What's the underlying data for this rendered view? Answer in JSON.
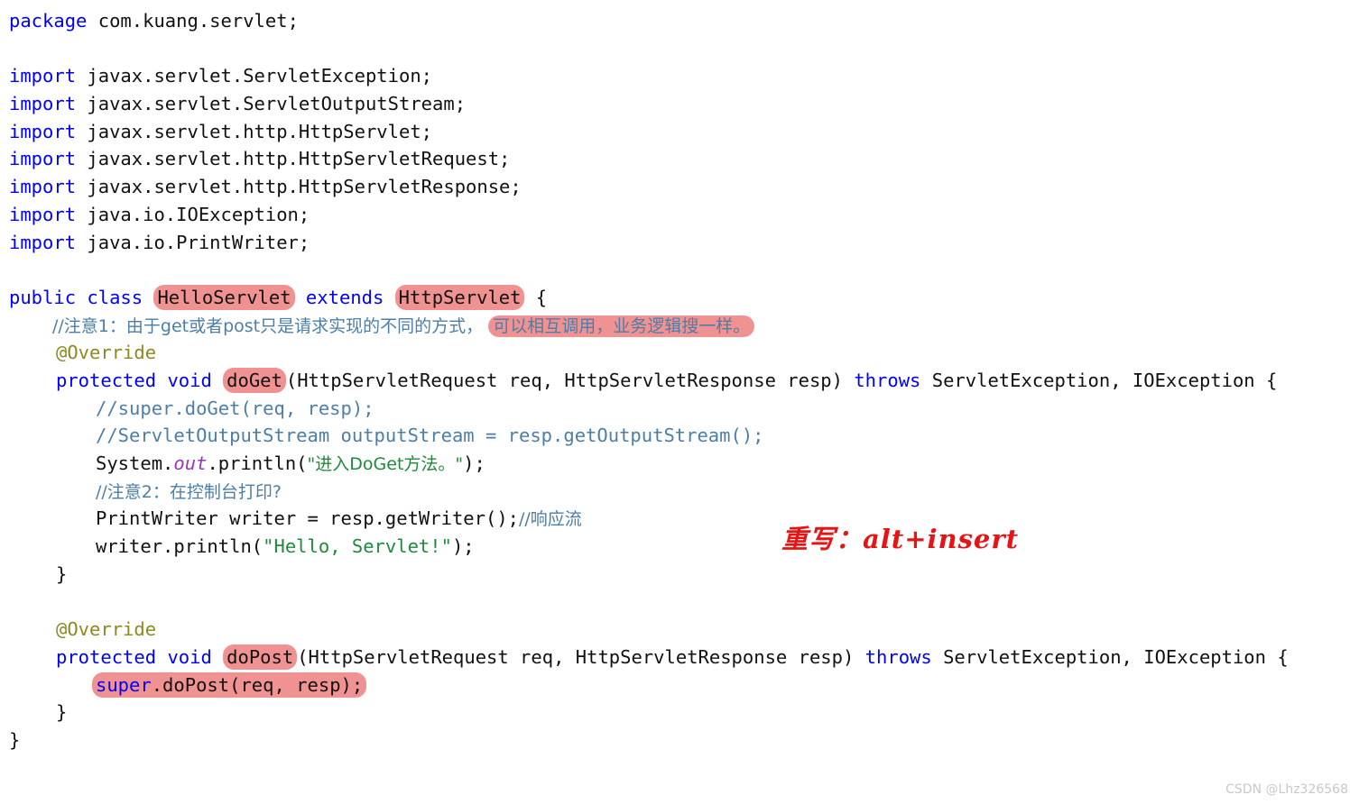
{
  "editor": {
    "language": "java",
    "colors": {
      "keyword": "#0000ff",
      "plain": "#111111",
      "comment": "#4c7ea8",
      "string": "#1f8a3c",
      "annotation": "#8a8a1f",
      "field": "#9a36b8",
      "highlight_pill": "#f19292",
      "red_note": "#e81414",
      "watermark": "#c8c8c8",
      "background": "#ffffff"
    },
    "lines": {
      "l1_kw": "package",
      "l1_rest": " com.kuang.servlet;",
      "l3_kw": "import",
      "l3_rest": " javax.servlet.ServletException;",
      "l4_kw": "import",
      "l4_rest": " javax.servlet.ServletOutputStream;",
      "l5_kw": "import",
      "l5_rest": " javax.servlet.http.HttpServlet;",
      "l6_kw": "import",
      "l6_rest": " javax.servlet.http.HttpServletRequest;",
      "l7_kw": "import",
      "l7_rest": " javax.servlet.http.HttpServletResponse;",
      "l8_kw": "import",
      "l8_rest": " java.io.IOException;",
      "l9_kw": "import",
      "l9_rest": " java.io.PrintWriter;",
      "l11_kw1": "public",
      "l11_kw2": "class",
      "l11_hl1": "HelloServlet",
      "l11_kw3": "extends",
      "l11_hl2": "HttpServlet",
      "l11_brace": "{",
      "l12_comment_plain": "//注意1：由于get或者post只是请求实现的不同的方式，",
      "l12_comment_highlight": "可以相互调用，业务逻辑搜一样。",
      "l13_annotation": "@Override",
      "l14_kw1": "protected",
      "l14_kw2": "void",
      "l14_hl": "doGet",
      "l14_params": "(HttpServletRequest req, HttpServletResponse resp) ",
      "l14_kw3": "throws",
      "l14_tail": " ServletException, IOException {",
      "l15_comment": "//super.doGet(req, resp);",
      "l16_comment": "//ServletOutputStream outputStream = resp.getOutputStream();",
      "l17_pre": "System.",
      "l17_field": "out",
      "l17_mid": ".println(",
      "l17_str": "\"进入DoGet方法。\"",
      "l17_post": ");",
      "l18_comment": "//注意2：在控制台打印?",
      "l19_code": "PrintWriter writer = resp.getWriter();",
      "l19_comment": "//响应流",
      "l20_pre": "writer.println(",
      "l20_str": "\"Hello, Servlet!\"",
      "l20_post": ");",
      "l21_brace": "}",
      "l23_annotation": "@Override",
      "l24_kw1": "protected",
      "l24_kw2": "void",
      "l24_hl": "doPost",
      "l24_params": "(HttpServletRequest req, HttpServletResponse resp) ",
      "l24_kw3": "throws",
      "l24_tail": " ServletException, IOException {",
      "l25_kw": "super",
      "l25_rest": ".doPost(req, resp);",
      "l26_brace": "}",
      "l27_brace": "}"
    }
  },
  "annotation_note": "重写：alt+insert",
  "watermark": "CSDN @Lhz326568"
}
